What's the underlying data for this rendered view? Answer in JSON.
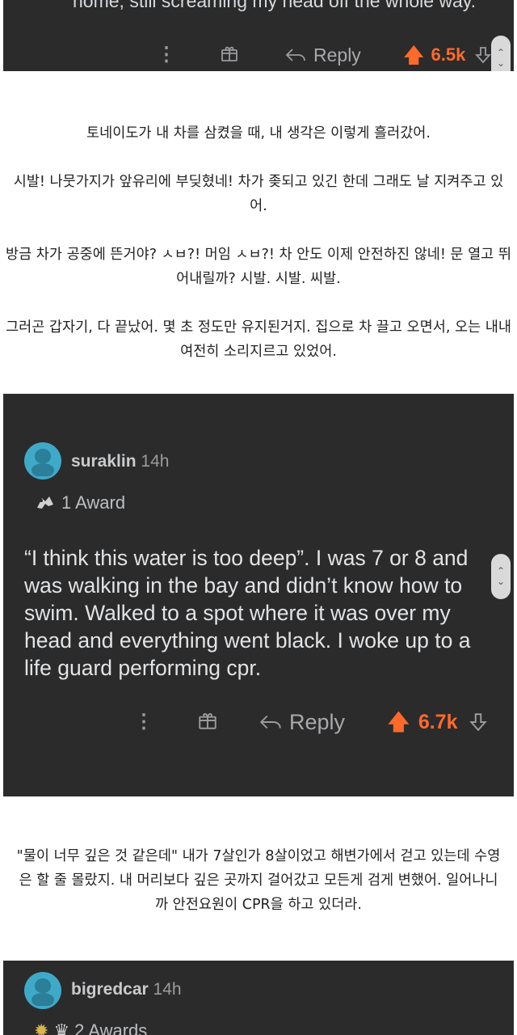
{
  "comment1": {
    "cut_text": "home, still screaming my head off the whole way.",
    "reply_label": "Reply",
    "score": "6.5k"
  },
  "translation1": [
    "토네이도가 내 차를 삼켰을 때, 내 생각은 이렇게 흘러갔어.",
    "시발! 나뭇가지가 앞유리에 부딪혔네! 차가 좆되고 있긴 한데 그래도 날 지켜주고 있어.",
    "방금 차가 공중에 뜬거야? ㅅㅂ?! 머임 ㅅㅂ?! 차 안도 이제 안전하진 않네! 문 열고 뛰어내릴까? 시발. 시발. 씨발.",
    "그러곤 갑자기, 다 끝났어. 몇 초 정도만 유지된거지. 집으로 차 끌고 오면서, 오는 내내 여전히 소리지르고 있었어."
  ],
  "comment2": {
    "username": "suraklin",
    "time": "14h",
    "award": "1 Award",
    "text": "“I think this water is too deep”. I was 7 or 8 and was walking in the bay and didn’t know how to swim. Walked to a spot where it was over my head and everything went black. I woke up to a life guard performing cpr.",
    "reply_label": "Reply",
    "score": "6.7k"
  },
  "translation2": [
    "\"물이 너무 깊은 것 같은데\" 내가 7살인가 8살이었고 해변가에서 걷고 있는데 수영은 할 줄 몰랐지. 내 머리보다 깊은 곳까지 걸어갔고 모든게 검게 변했어. 일어나니까 안전요원이 CPR을 하고 있더라."
  ],
  "comment3": {
    "username": "bigredcar",
    "time": "14h",
    "award": "2 Awards"
  },
  "icons": {
    "more": "more-options-icon",
    "gift": "gift-award-icon",
    "reply": "reply-arrow-icon",
    "upvote": "upvote-arrow-icon",
    "downvote": "downvote-arrow-icon"
  },
  "colors": {
    "card_bg": "#2b2b2c",
    "upvote_orange": "#ff6a2b",
    "avatar_blue": "#3fa9c8"
  }
}
